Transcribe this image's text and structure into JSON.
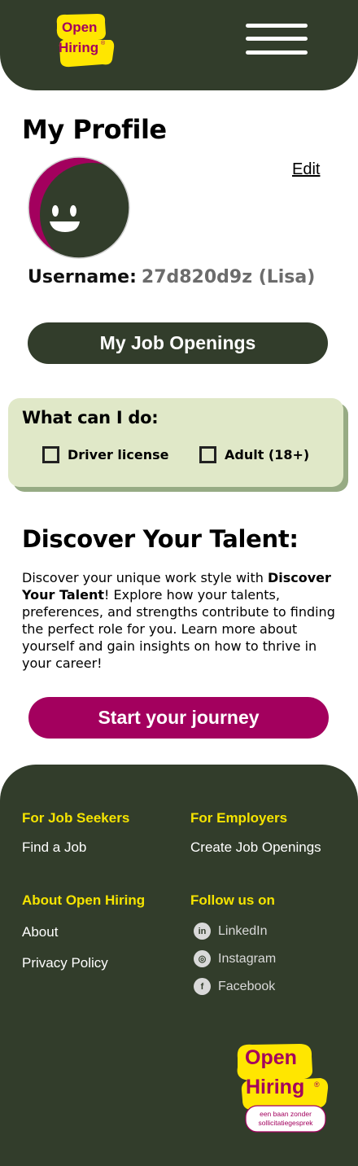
{
  "header": {
    "logo": {
      "line1": "Open",
      "line2": "Hiring",
      "mark": "®"
    },
    "menu_icon": "hamburger-menu-icon"
  },
  "profile": {
    "title": "My Profile",
    "edit_label": "Edit",
    "username_label": "Username:",
    "username_value": "27d820d9z (Lisa)"
  },
  "job_openings_button": "My Job Openings",
  "skills": {
    "title": "What can I do:",
    "options": [
      {
        "label": "Driver license",
        "checked": false
      },
      {
        "label": "Adult (18+)",
        "checked": false
      }
    ]
  },
  "discover": {
    "title": "Discover Your Talent:",
    "text_before": "Discover your unique work style with ",
    "text_bold": "Discover Your Talent",
    "text_after": "! Explore how your talents, preferences, and strengths contribute to finding the perfect role for you. Learn more about yourself and gain insights on how to thrive in your career!",
    "button": "Start your journey"
  },
  "footer": {
    "job_seekers": {
      "heading": "For Job Seekers",
      "links": [
        "Find a Job"
      ]
    },
    "employers": {
      "heading": "For Employers",
      "links": [
        "Create Job Openings"
      ]
    },
    "about": {
      "heading": "About Open Hiring",
      "links": [
        "About",
        "Privacy Policy"
      ]
    },
    "follow": {
      "heading": "Follow us on",
      "links": [
        {
          "label": "LinkedIn",
          "icon": "linkedin-icon",
          "glyph": "in"
        },
        {
          "label": "Instagram",
          "icon": "instagram-icon",
          "glyph": "◎"
        },
        {
          "label": "Facebook",
          "icon": "facebook-icon",
          "glyph": "f"
        }
      ]
    },
    "logo": {
      "line1": "Open",
      "line2": "Hiring",
      "mark": "®",
      "tagline1": "een baan zonder",
      "tagline2": "sollicitatiegesprek"
    }
  },
  "colors": {
    "dark_green": "#323d2b",
    "brand_yellow": "#ffe600",
    "brand_magenta": "#a3005e",
    "card_bg": "#e0e8c8",
    "card_shadow": "#97ab84",
    "footer_heading": "#f5e400"
  }
}
